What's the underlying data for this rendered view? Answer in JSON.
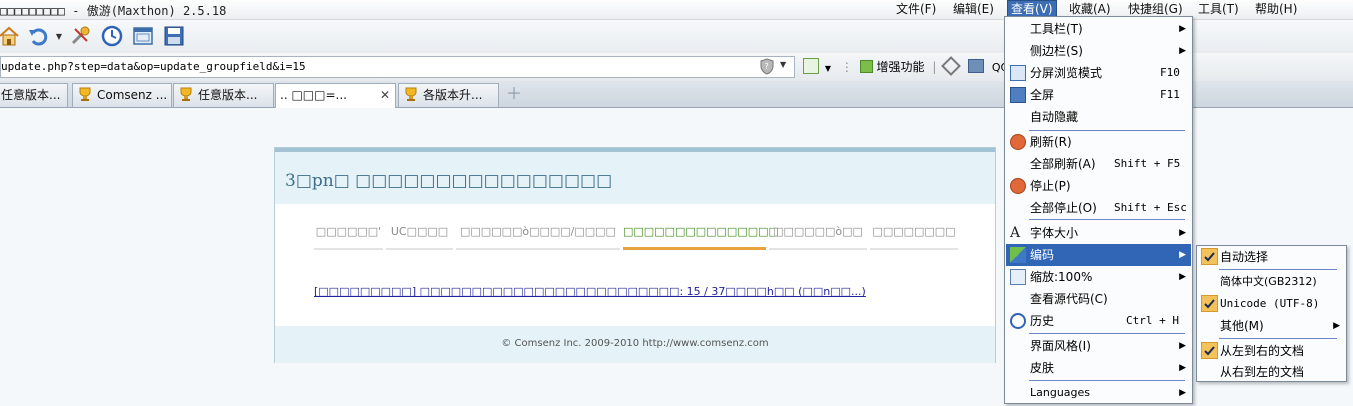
{
  "window": {
    "title": "□□□□□□□□□ - 傲游(Maxthon) 2.5.18"
  },
  "menubar": {
    "items": [
      {
        "label": "文件(F)"
      },
      {
        "label": "编辑(E)"
      },
      {
        "label": "查看(V)"
      },
      {
        "label": "收藏(A)"
      },
      {
        "label": "快捷组(G)"
      },
      {
        "label": "工具(T)"
      },
      {
        "label": "帮助(H)"
      }
    ]
  },
  "address": {
    "url": "update.php?step=data&op=update_groupfield&i=15"
  },
  "toolbar_right": {
    "enhance_label": "增强功能",
    "qq_label": "QQ截"
  },
  "tabs": [
    {
      "label": "任意版本..."
    },
    {
      "label": "Comsenz ..."
    },
    {
      "label": "任意版本..."
    },
    {
      "label": ".. □□□=..."
    },
    {
      "label": "各版本升..."
    }
  ],
  "page": {
    "title": "3□pn□ □□□□□□□□□□□□□□□□",
    "steps": [
      {
        "label": "□□□□□□'"
      },
      {
        "label": "UC□□□□"
      },
      {
        "label": "□□□□□□ò□□□□/□□□□"
      },
      {
        "label": "□□□□□□□□□□□□□□□"
      },
      {
        "label": "□□□□□□ò□□"
      },
      {
        "label": "□□□□□□□□"
      }
    ],
    "current_step": 3,
    "progress_text": "[□□□□□□□□□] □□□□□□□□□□□□□□□□□□□□□□□□□: 15 / 37□□□□h□□ (□□n□□...)",
    "footer": "© Comsenz Inc. 2009-2010 http://www.comsenz.com"
  },
  "view_menu": {
    "items": [
      {
        "label": "工具栏(T)",
        "submenu": true
      },
      {
        "label": "侧边栏(S)",
        "submenu": true
      },
      {
        "label": "分屏浏览模式",
        "shortcut": "F10"
      },
      {
        "label": "全屏",
        "shortcut": "F11"
      },
      {
        "label": "自动隐藏"
      },
      {
        "label": "刷新(R)"
      },
      {
        "label": "全部刷新(A)",
        "shortcut": "Shift + F5"
      },
      {
        "label": "停止(P)"
      },
      {
        "label": "全部停止(O)",
        "shortcut": "Shift + Esc"
      },
      {
        "label": "字体大小",
        "submenu": true
      },
      {
        "label": "编码",
        "submenu": true
      },
      {
        "label": "缩放:100%",
        "submenu": true
      },
      {
        "label": "查看源代码(C)"
      },
      {
        "label": "历史",
        "shortcut": "Ctrl + H"
      },
      {
        "label": "界面风格(I)",
        "submenu": true
      },
      {
        "label": "皮肤",
        "submenu": true
      },
      {
        "label": "Languages",
        "submenu": true
      }
    ]
  },
  "encoding_menu": {
    "items": [
      {
        "label": "自动选择",
        "checked": true
      },
      {
        "label": "简体中文(GB2312)",
        "checked": false
      },
      {
        "label": "Unicode (UTF-8)",
        "checked": true
      },
      {
        "label": "其他(M)",
        "checked": false,
        "submenu": true
      },
      {
        "label": "从左到右的文档",
        "checked": true
      },
      {
        "label": "从右到左的文档",
        "checked": false
      }
    ]
  },
  "colors": {
    "menu_highlight": "#3165b6",
    "active_step": "#3e8a1a",
    "step_underline": "#e8a33d",
    "link": "#22229a"
  }
}
